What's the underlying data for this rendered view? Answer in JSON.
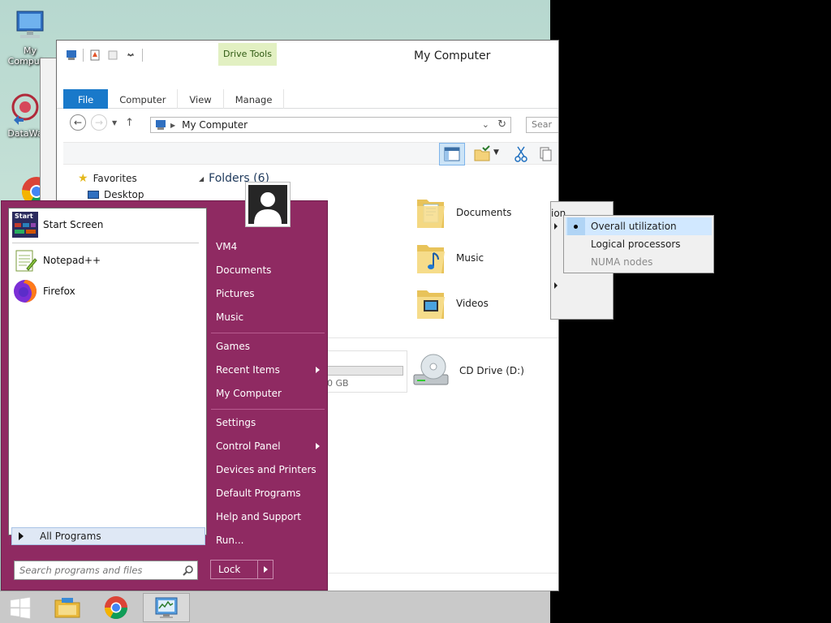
{
  "desktop": {
    "icons": [
      {
        "label": "My Computer"
      },
      {
        "label": "DataWa"
      }
    ]
  },
  "explorer": {
    "title": "My Computer",
    "context_tab": "Drive Tools",
    "tabs": [
      "File",
      "Computer",
      "View",
      "Manage"
    ],
    "address": "My Computer",
    "search_placeholder": "Sear",
    "nav": {
      "favorites": "Favorites",
      "desktop": "Desktop"
    },
    "folders_header": "Folders (6)",
    "folders": [
      "Documents",
      "Music",
      "Videos"
    ],
    "drive_size_fragment": "0 GB",
    "cd_drive": "CD Drive (D:)"
  },
  "context_menu": {
    "behind_fragment": "ion",
    "items": [
      {
        "label": "Overall utilization",
        "selected": true
      },
      {
        "label": "Logical processors"
      },
      {
        "label": "NUMA nodes",
        "disabled": true
      }
    ]
  },
  "start_menu": {
    "programs": [
      {
        "label": "Start Screen",
        "icon_text": "Start"
      },
      {
        "label": "Notepad++"
      },
      {
        "label": "Firefox"
      }
    ],
    "all_programs": "All Programs",
    "search_placeholder": "Search programs and files",
    "right_links": [
      "VM4",
      "Documents",
      "Pictures",
      "Music",
      "Games",
      "Recent Items",
      "My Computer",
      "Settings",
      "Control Panel",
      "Devices and Printers",
      "Default Programs",
      "Help and Support",
      "Run..."
    ],
    "lock_label": "Lock"
  },
  "colors": {
    "start_menu_bg": "#8f2a62",
    "file_tab": "#1979ca",
    "drive_tools": "#e2f0c2",
    "selection": "#d1e8ff"
  }
}
